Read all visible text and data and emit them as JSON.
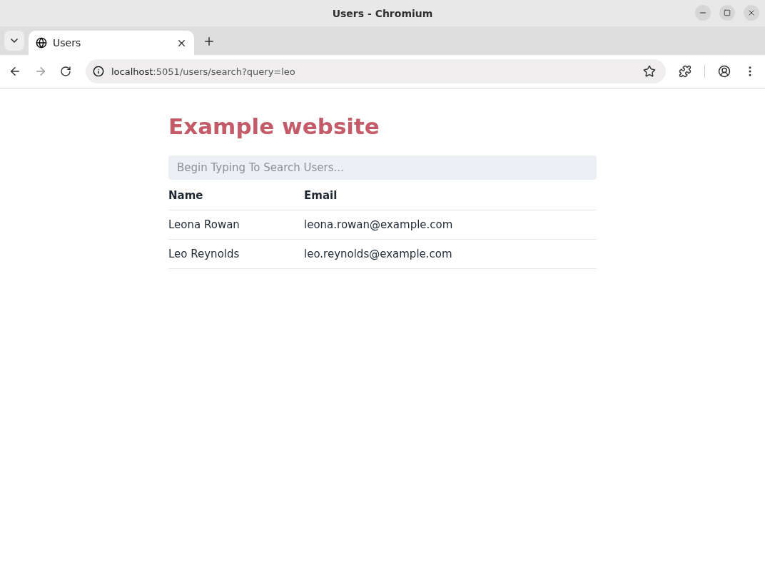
{
  "window": {
    "title": "Users - Chromium"
  },
  "tabs": [
    {
      "label": "Users",
      "selected": true
    }
  ],
  "address_bar": {
    "host": "localhost",
    "path": ":5051/users/search?query=leo"
  },
  "page": {
    "heading": "Example website",
    "search": {
      "placeholder": "Begin Typing To Search Users..."
    },
    "table": {
      "columns": [
        "Name",
        "Email"
      ],
      "rows": [
        [
          "Leona Rowan",
          "leona.rowan@example.com"
        ],
        [
          "Leo Reynolds",
          "leo.reynolds@example.com"
        ]
      ]
    }
  }
}
